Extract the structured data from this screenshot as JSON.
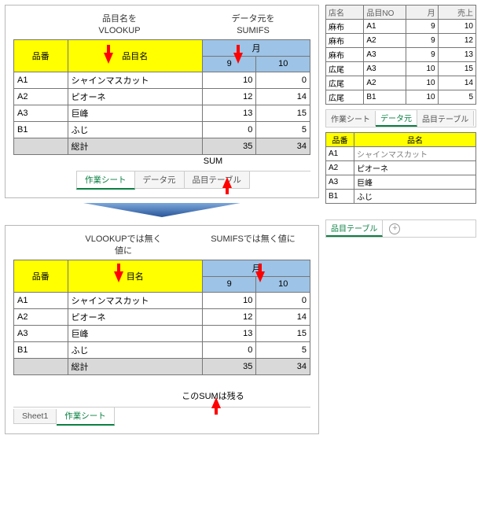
{
  "top": {
    "caption1a": "品目名を",
    "caption1b": "VLOOKUP",
    "caption2a": "データ元を",
    "caption2b": "SUMIFS",
    "headers": {
      "hinban": "品番",
      "hinmokumei": "品目名",
      "tsuki": "月",
      "m9": "9",
      "m10": "10"
    },
    "rows": [
      {
        "code": "A1",
        "name": "シャインマスカット",
        "v9": "10",
        "v10": "0"
      },
      {
        "code": "A2",
        "name": "ピオーネ",
        "v9": "12",
        "v10": "14"
      },
      {
        "code": "A3",
        "name": "巨峰",
        "v9": "13",
        "v10": "15"
      },
      {
        "code": "B1",
        "name": "ふじ",
        "v9": "0",
        "v10": "5"
      }
    ],
    "total": {
      "label": "総計",
      "v9": "35",
      "v10": "34"
    },
    "sum_label": "SUM"
  },
  "bottom": {
    "caption1a": "VLOOKUPでは無く",
    "caption1b": "値に",
    "caption2": "SUMIFSでは無く値に",
    "headers": {
      "hinban": "品番",
      "hinmokumei": "目名",
      "tsuki": "月",
      "m9": "9",
      "m10": "10"
    },
    "rows": [
      {
        "code": "A1",
        "name": "シャインマスカット",
        "v9": "10",
        "v10": "0"
      },
      {
        "code": "A2",
        "name": "ピオーネ",
        "v9": "12",
        "v10": "14"
      },
      {
        "code": "A3",
        "name": "巨峰",
        "v9": "13",
        "v10": "15"
      },
      {
        "code": "B1",
        "name": "ふじ",
        "v9": "0",
        "v10": "5"
      }
    ],
    "total": {
      "label": "総計",
      "v9": "35",
      "v10": "34"
    },
    "sum_label": "このSUMは残る"
  },
  "tabs_top": {
    "t1": "作業シート",
    "t2": "データ元",
    "t3": "品目テーブル"
  },
  "tabs_bottom": {
    "t1": "Sheet1",
    "t2": "作業シート"
  },
  "source": {
    "headers": {
      "tenmei": "店名",
      "hinmokuNo": "品目NO",
      "tsuki": "月",
      "uriage": "売上"
    },
    "rows": [
      {
        "ten": "麻布",
        "no": "A1",
        "m": "9",
        "u": "10"
      },
      {
        "ten": "麻布",
        "no": "A2",
        "m": "9",
        "u": "12"
      },
      {
        "ten": "麻布",
        "no": "A3",
        "m": "9",
        "u": "13"
      },
      {
        "ten": "広尾",
        "no": "A3",
        "m": "10",
        "u": "15"
      },
      {
        "ten": "広尾",
        "no": "A2",
        "m": "10",
        "u": "14"
      },
      {
        "ten": "広尾",
        "no": "B1",
        "m": "10",
        "u": "5"
      }
    ]
  },
  "tabs_src": {
    "t1": "作業シート",
    "t2": "データ元",
    "t3": "品目テーブル"
  },
  "lookup": {
    "headers": {
      "hinban": "品番",
      "hinmei": "品名"
    },
    "rows": [
      {
        "code": "A1",
        "name": "シャインマスカット"
      },
      {
        "code": "A2",
        "name": "ピオーネ"
      },
      {
        "code": "A3",
        "name": "巨峰"
      },
      {
        "code": "B1",
        "name": "ふじ"
      }
    ]
  },
  "tabs_lookup": {
    "t1": "品目テーブル"
  }
}
